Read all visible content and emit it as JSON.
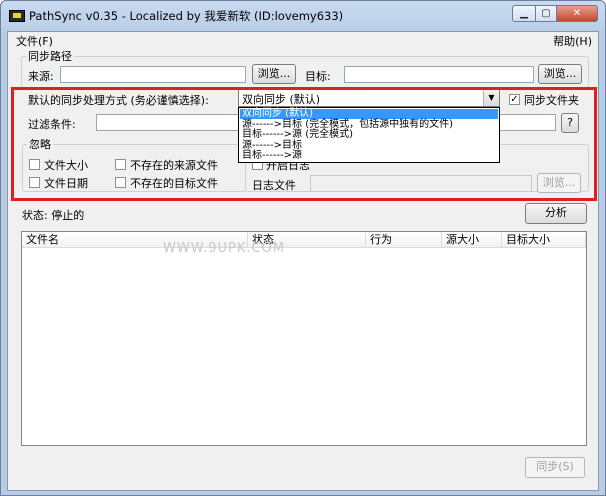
{
  "window": {
    "title": "PathSync v0.35 - Localized by 我爱新软 (ID:lovemy633)",
    "controls": {
      "minimize": "▁",
      "maximize": "▢",
      "close": "✕"
    }
  },
  "menu": {
    "file": "文件(F)",
    "help": "帮助(H)"
  },
  "paths": {
    "group_label": "同步路径",
    "source_label": "来源:",
    "source_value": "",
    "source_browse": "浏览...",
    "target_label": "目标:",
    "target_value": "",
    "target_browse": "浏览..."
  },
  "sync_mode": {
    "label": "默认的同步处理方式 (务必谨慎选择):",
    "selected": "双向同步 (默认)",
    "options": [
      "双向同步 (默认)",
      "源------>目标 (完全模式，包括源中独有的文件)",
      "目标------>源 (完全模式)",
      "源------>目标",
      "目标------>源"
    ],
    "sync_folders_label": "同步文件夹",
    "sync_folders_checked": true
  },
  "filter": {
    "label": "过滤条件:",
    "value": "",
    "help_button": "?"
  },
  "ignore": {
    "group_label": "忽略",
    "file_size": "文件大小",
    "file_date": "文件日期",
    "missing_source": "不存在的来源文件",
    "missing_target": "不存在的目标文件"
  },
  "log": {
    "enable_label": "开启日志",
    "file_label": "日志文件",
    "file_value": "",
    "browse": "浏览..."
  },
  "status": {
    "text": "状态: 停止的",
    "analyze_button": "分析"
  },
  "file_list": {
    "columns": [
      "文件名",
      "状态",
      "行为",
      "源大小",
      "目标大小"
    ],
    "rows": []
  },
  "watermark": "WWW.9UPK.COM",
  "sync_button": "同步(S)",
  "colors": {
    "highlight_border": "#e02020",
    "selection": "#3399ff"
  }
}
